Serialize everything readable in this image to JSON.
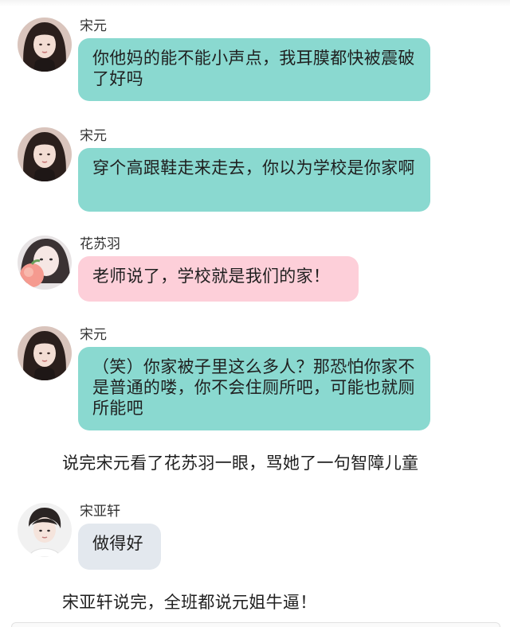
{
  "messages": [
    {
      "sender": "宋元",
      "text": "你他妈的能不能小声点，我耳膜都快被震破了好吗",
      "color": "#8ad9d0",
      "avatar": "girl-long-dark-hair"
    },
    {
      "sender": "宋元",
      "text": "穿个高跟鞋走来走去，你以为学校是你家啊",
      "color": "#8ad9d0",
      "avatar": "girl-long-dark-hair"
    },
    {
      "sender": "花苏羽",
      "text": "老师说了，学校就是我们的家！",
      "color": "#fdcfd9",
      "avatar": "girl-with-peach"
    },
    {
      "sender": "宋元",
      "text": "（笑）你家被子里这么多人？那恐怕你家不是普通的喽，你不会住厕所吧，可能也就厕所能吧",
      "color": "#8ad9d0",
      "avatar": "girl-long-dark-hair"
    },
    {
      "sender": "宋亚轩",
      "text": "做得好",
      "color": "#e3e8ee",
      "avatar": "boy-short-hair"
    }
  ],
  "narrations": [
    "说完宋元看了花苏羽一眼，骂她了一句智障儿童",
    "宋亚轩说完，全班都说元姐牛逼！"
  ]
}
